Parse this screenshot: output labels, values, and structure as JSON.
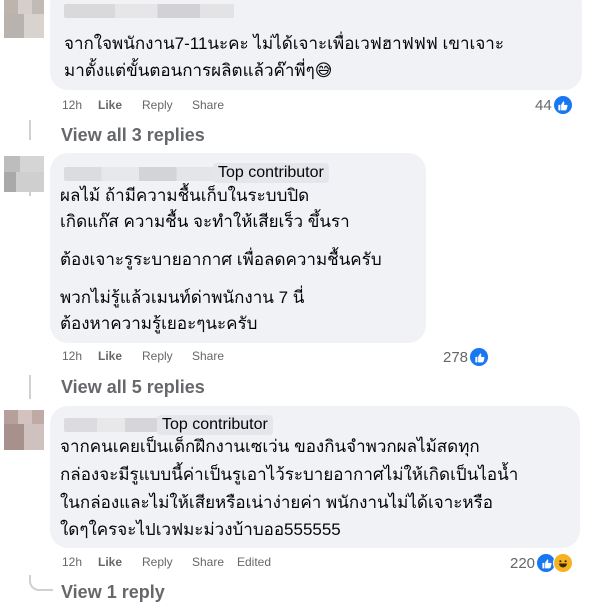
{
  "comments": [
    {
      "lines": [
        "จากใจพนักงาน7-11นะคะ ไม่ได้เจาะเพื่อเวฟฮาฟฟฟ เขาเจาะ",
        "มาตั้งแต่ขั้นตอนการผลิตแล้วค๊าพี่ๆ😅"
      ],
      "badge": "",
      "time": "12h",
      "like": "Like",
      "reply": "Reply",
      "share": "Share",
      "edited": "",
      "reaction_count": "44",
      "view_replies": "View all 3 replies"
    },
    {
      "lines": [
        "ผลไม้ ถ้ามีความชื้นเก็บในระบบปิด",
        "เกิดแก๊ส ความชื้น จะทำให้เสียเร็ว ขึ้นรา",
        "ต้องเจาะรูระบายอากาศ เพื่อลดความชื้นครับ",
        "พวกไม่รู้แล้วเมนท์ด่าพนักงาน 7 นี่",
        "ต้องหาความรู้เยอะๆนะครับ"
      ],
      "badge": "Top contributor",
      "time": "12h",
      "like": "Like",
      "reply": "Reply",
      "share": "Share",
      "edited": "",
      "reaction_count": "278",
      "view_replies": "View all 5 replies"
    },
    {
      "lines": [
        "จากคนเคยเป็นเด็กฝึกงานเซเว่น ของกินจำพวกผลไม้สดทุก",
        "กล่องจะมีรูแบบนี้ค่าเป็นรูเอาไว้ระบายอากาศไม่ให้เกิดเป็นไอน้ำ",
        "ในกล่องและไม่ให้เสียหรือเน่าง่ายค่า พนักงานไม่ได้เจาะหรือ",
        "ใดๆใครจะไปเวฟมะม่วงบ้าบออ555555"
      ],
      "badge": "Top contributor",
      "time": "12h",
      "like": "Like",
      "reply": "Reply",
      "share": "Share",
      "edited": "Edited",
      "reaction_count": "220",
      "view_replies": "View 1 reply"
    }
  ],
  "icons": {
    "like": "like-reaction-icon",
    "haha": "haha-reaction-icon"
  },
  "colors": {
    "bubble": "#f0f2f5",
    "like_blue": "#1877f2",
    "meta_gray": "#65676b",
    "badge_bg": "#e4e6eb"
  }
}
